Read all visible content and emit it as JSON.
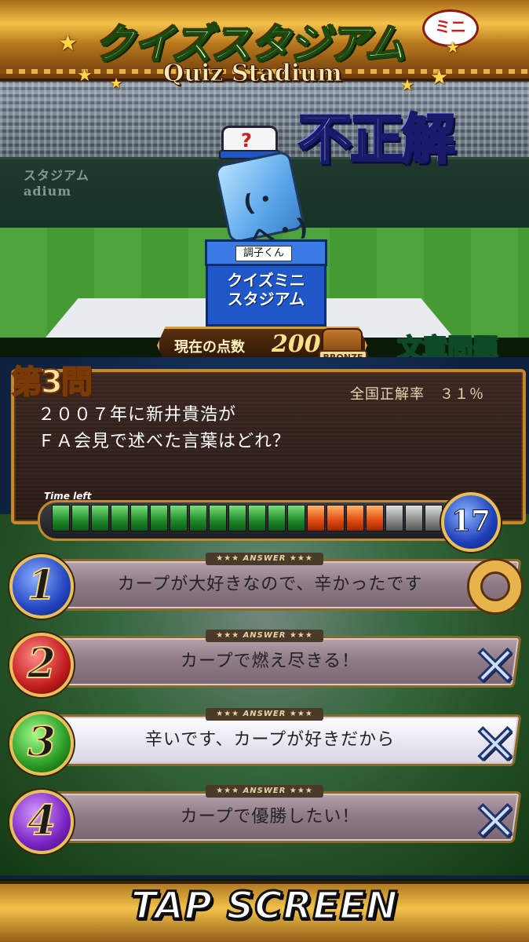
{
  "header": {
    "logo_jp": "クイズスタジアム",
    "logo_mini": "ミニ",
    "logo_en": "Quiz Stadium",
    "wall_logo": "スタジアム",
    "wall_logo_sub": "adium"
  },
  "result": "不正解",
  "mascot": {
    "hat_mark": "?",
    "face": "(・へ・)",
    "name_label": "調子くん",
    "box_text": "クイズミニ\nスタジアム"
  },
  "score": {
    "label": "現在の点数",
    "value": "200",
    "rank": "BRONZE"
  },
  "question_type": "文章問題",
  "question": {
    "number_label": "第3問",
    "rate_label": "全国正解率　３１％",
    "text": "２００７年に新井貴浩が\nＦＡ会見で述べた言葉はどれ？"
  },
  "timer": {
    "label": "Time left",
    "seconds": "17",
    "remaining_ticks": 17,
    "total_ticks": 20
  },
  "answers": [
    {
      "num": "1",
      "tag": "★★★ ANSWER ★★★",
      "text": "カープが大好きなので、辛かったです",
      "mark": "correct"
    },
    {
      "num": "2",
      "tag": "★★★ ANSWER ★★★",
      "text": "カープで燃え尽きる！",
      "mark": "wrong"
    },
    {
      "num": "3",
      "tag": "★★★ ANSWER ★★★",
      "text": "辛いです、カープが好きだから",
      "mark": "wrong"
    },
    {
      "num": "4",
      "tag": "★★★ ANSWER ★★★",
      "text": "カープで優勝したい！",
      "mark": "wrong"
    }
  ],
  "marks": {
    "correct": "◯",
    "wrong": "✕"
  },
  "footer": {
    "tap_label": "TAP SCREEN"
  },
  "colors": {
    "gold": "#d7a23c",
    "result_blue": "#1a1a6a",
    "timer_green": "#1f8a2a",
    "timer_red": "#e34a10"
  }
}
